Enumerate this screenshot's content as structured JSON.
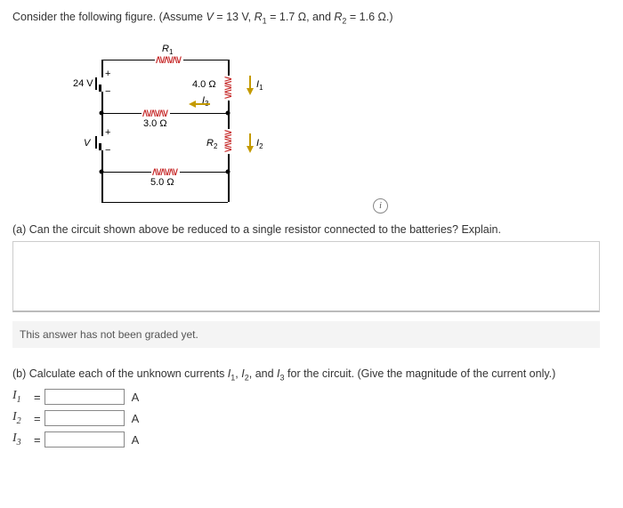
{
  "prompt": {
    "intro": "Consider the following figure. (Assume ",
    "assume_V_lhs": "V",
    "assume_V_eq": " = ",
    "assume_V_val": "13 V",
    "sep1": ", ",
    "assume_R1_lhs": "R",
    "assume_R1_sub": "1",
    "assume_R1_eq": " = ",
    "assume_R1_val": "1.7 Ω",
    "sep2": ", and ",
    "assume_R2_lhs": "R",
    "assume_R2_sub": "2",
    "assume_R2_eq": " = ",
    "assume_R2_val": "1.6 Ω",
    "close": ".)"
  },
  "circuit": {
    "src24": "24 V",
    "srcV": "V",
    "plus": "+",
    "minus": "−",
    "R1": "R",
    "R1_sub": "1",
    "R_4ohm": "4.0 Ω",
    "I3": "I",
    "I3_sub": "3",
    "R_3ohm": "3.0 Ω",
    "R2": "R",
    "R2_sub": "2",
    "R_5ohm": "5.0 Ω",
    "I1": "I",
    "I1_sub": "1",
    "I2": "I",
    "I2_sub": "2"
  },
  "info_icon": "i",
  "partA": {
    "label": "(a) Can the circuit shown above be reduced to a single resistor connected to the batteries? Explain."
  },
  "grade_msg": "This answer has not been graded yet.",
  "partB": {
    "intro_a": "(b) Calculate each of the unknown currents ",
    "I1": "I",
    "I1_sub": "1",
    "sep1": ", ",
    "I2": "I",
    "I2_sub": "2",
    "sep2": ", and ",
    "I3": "I",
    "I3_sub": "3",
    "intro_b": " for the circuit. (Give the magnitude of the current only.)",
    "rows": [
      {
        "var": "I",
        "sub": "1",
        "eq": "=",
        "unit": "A"
      },
      {
        "var": "I",
        "sub": "2",
        "eq": "=",
        "unit": "A"
      },
      {
        "var": "I",
        "sub": "3",
        "eq": "=",
        "unit": "A"
      }
    ]
  }
}
